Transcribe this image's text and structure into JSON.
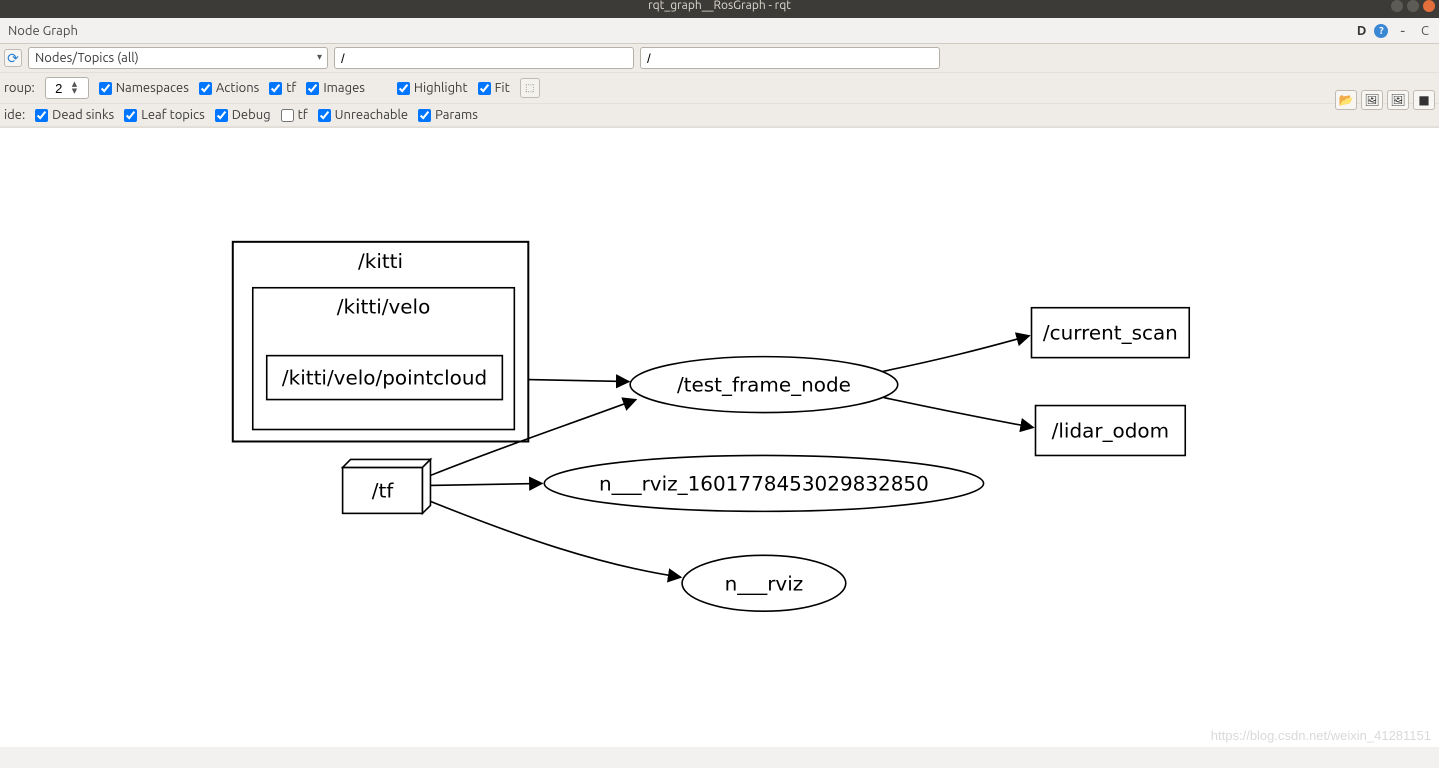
{
  "window": {
    "title": "rqt_graph__RosGraph - rqt"
  },
  "menubar": {
    "title": "Node Graph",
    "d_label": "D",
    "help": "?"
  },
  "toolbar": {
    "refresh_icon_title": "Refresh",
    "combo_value": "Nodes/Topics (all)",
    "filter1": "/",
    "filter2": "/"
  },
  "row_group": {
    "group_label": "roup:",
    "group_value": "2",
    "namespaces": "Namespaces",
    "actions": "Actions",
    "tf": "tf",
    "images": "Images",
    "highlight": "Highlight",
    "fit": "Fit"
  },
  "row_hide": {
    "hide_label": "ide:",
    "dead_sinks": "Dead sinks",
    "leaf_topics": "Leaf topics",
    "debug": "Debug",
    "tf": "tf",
    "unreachable": "Unreachable",
    "params": "Params"
  },
  "checkboxes": {
    "namespaces": true,
    "actions": true,
    "tf1": true,
    "images": true,
    "highlight": true,
    "fit": true,
    "dead_sinks": true,
    "leaf_topics": true,
    "debug": true,
    "tf2": false,
    "unreachable": true,
    "params": true
  },
  "graph": {
    "groups": [
      {
        "id": "kitti",
        "label": "/kitti"
      },
      {
        "id": "kitti_velo",
        "label": "/kitti/velo"
      }
    ],
    "nodes": [
      {
        "id": "pointcloud",
        "label": "/kitti/velo/pointcloud",
        "type": "topic-rect"
      },
      {
        "id": "tf",
        "label": "/tf",
        "type": "topic-3d"
      },
      {
        "id": "test_frame_node",
        "label": "/test_frame_node",
        "type": "node-ellipse"
      },
      {
        "id": "rviz_long",
        "label": "n___rviz_1601778453029832850",
        "type": "node-ellipse"
      },
      {
        "id": "rviz",
        "label": "n___rviz",
        "type": "node-ellipse"
      },
      {
        "id": "current_scan",
        "label": "/current_scan",
        "type": "topic-rect"
      },
      {
        "id": "lidar_odom",
        "label": "/lidar_odom",
        "type": "topic-rect"
      }
    ],
    "edges": [
      {
        "from": "pointcloud",
        "to": "test_frame_node"
      },
      {
        "from": "tf",
        "to": "test_frame_node"
      },
      {
        "from": "tf",
        "to": "rviz_long"
      },
      {
        "from": "tf",
        "to": "rviz"
      },
      {
        "from": "test_frame_node",
        "to": "current_scan"
      },
      {
        "from": "test_frame_node",
        "to": "lidar_odom"
      }
    ]
  },
  "watermark": "https://blog.csdn.net/weixin_41281151"
}
